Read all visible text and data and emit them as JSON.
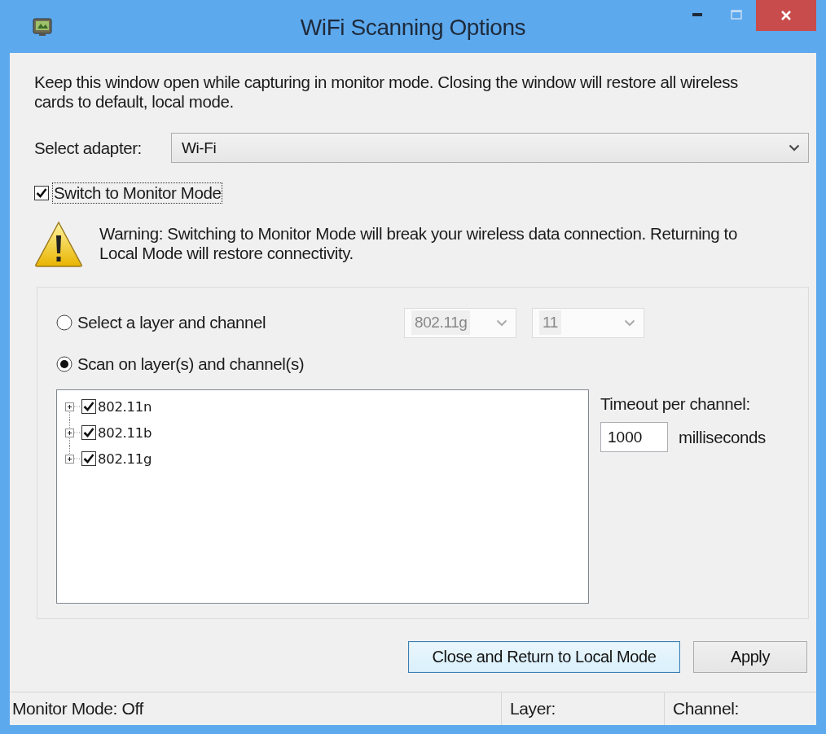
{
  "window": {
    "title": "WiFi Scanning Options"
  },
  "intro": "Keep this window open while capturing in monitor mode. Closing the window will restore all wireless cards to default, local mode.",
  "adapter": {
    "label": "Select adapter:",
    "value": "Wi-Fi"
  },
  "monitor_mode": {
    "label": "Switch to Monitor Mode",
    "checked": true
  },
  "warning": "Warning: Switching to Monitor Mode will break your wireless data connection. Returning to Local Mode will restore connectivity.",
  "scan_modes": [
    {
      "label": "Select a layer and channel",
      "selected": false
    },
    {
      "label": "Scan on layer(s) and channel(s)",
      "selected": true
    }
  ],
  "layer_select": {
    "value": "802.11g",
    "disabled": true
  },
  "channel_select": {
    "value": "11",
    "disabled": true
  },
  "layers": [
    {
      "label": "802.11n",
      "checked": true,
      "expanded": false
    },
    {
      "label": "802.11b",
      "checked": true,
      "expanded": false
    },
    {
      "label": "802.11g",
      "checked": true,
      "expanded": false
    }
  ],
  "timeout": {
    "label": "Timeout per channel:",
    "value": "1000",
    "unit": "milliseconds"
  },
  "buttons": [
    {
      "label": "Close and Return to Local Mode",
      "focused": true
    },
    {
      "label": "Apply",
      "focused": false
    }
  ],
  "status_bar": [
    "Monitor Mode: Off",
    "Layer:",
    "Channel:"
  ]
}
